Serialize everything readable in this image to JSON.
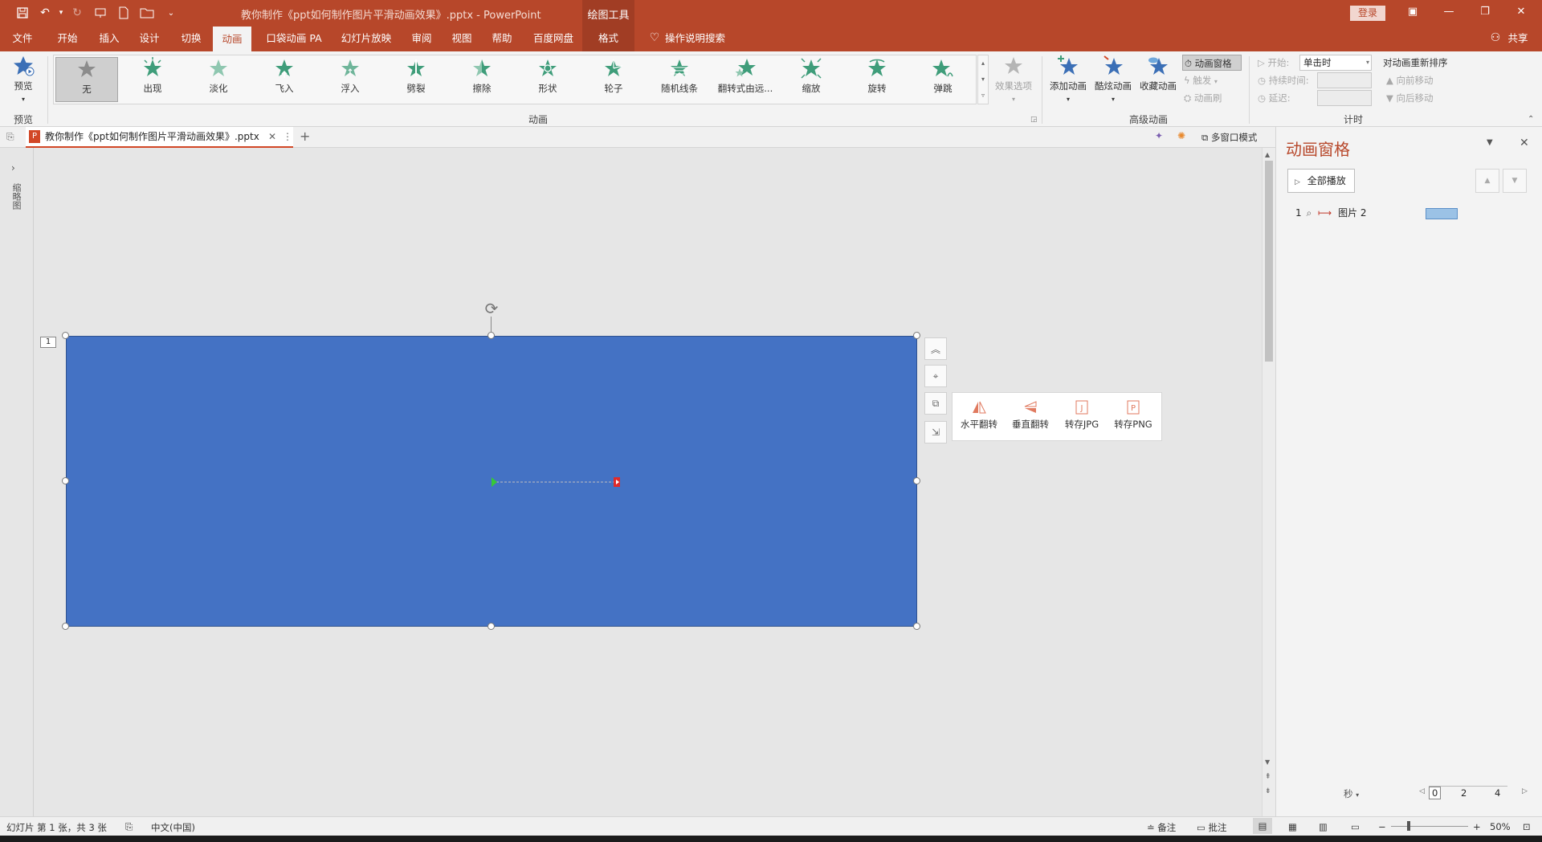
{
  "window": {
    "title": "教你制作《ppt如何制作图片平滑动画效果》.pptx - PowerPoint",
    "context_tools": "绘图工具",
    "login": "登录",
    "share": "共享"
  },
  "qat": {
    "customize": "⌄"
  },
  "tabs": [
    {
      "label": "文件"
    },
    {
      "label": "开始"
    },
    {
      "label": "插入"
    },
    {
      "label": "设计"
    },
    {
      "label": "切换"
    },
    {
      "label": "动画"
    },
    {
      "label": "口袋动画 PA"
    },
    {
      "label": "幻灯片放映"
    },
    {
      "label": "审阅"
    },
    {
      "label": "视图"
    },
    {
      "label": "帮助"
    },
    {
      "label": "百度网盘"
    },
    {
      "label": "格式"
    }
  ],
  "tell_me": "操作说明搜索",
  "ribbon": {
    "preview": {
      "label": "预览",
      "group": "预览"
    },
    "animations_group": "动画",
    "gallery": [
      {
        "label": "无"
      },
      {
        "label": "出现"
      },
      {
        "label": "淡化"
      },
      {
        "label": "飞入"
      },
      {
        "label": "浮入"
      },
      {
        "label": "劈裂"
      },
      {
        "label": "擦除"
      },
      {
        "label": "形状"
      },
      {
        "label": "轮子"
      },
      {
        "label": "随机线条"
      },
      {
        "label": "翻转式由远..."
      },
      {
        "label": "缩放"
      },
      {
        "label": "旋转"
      },
      {
        "label": "弹跳"
      }
    ],
    "effect_options": "效果选项",
    "advanced": {
      "group": "高级动画",
      "add_animation": "添加动画",
      "fancy_animation": "酷炫动画",
      "favorite_animation": "收藏动画",
      "animation_pane": "动画窗格",
      "trigger": "触发",
      "animation_painter": "动画刷"
    },
    "timing": {
      "group": "计时",
      "start_label": "开始:",
      "start_value": "单击时",
      "duration_label": "持续时间:",
      "delay_label": "延迟:",
      "reorder": "对动画重新排序",
      "move_earlier": "向前移动",
      "move_later": "向后移动"
    }
  },
  "doc_tab": {
    "name": "教你制作《ppt如何制作图片平滑动画效果》.pptx"
  },
  "left_rail": {
    "label": "缩略图"
  },
  "slide": {
    "anim_tag": "1"
  },
  "flip_panel": [
    {
      "label": "水平翻转"
    },
    {
      "label": "垂直翻转"
    },
    {
      "label": "转存JPG"
    },
    {
      "label": "转存PNG"
    }
  ],
  "animation_pane": {
    "title": "动画窗格",
    "play_all": "全部播放",
    "items": [
      {
        "index": "1",
        "name": "图片 2"
      }
    ],
    "seconds": "秒",
    "timeline": [
      "0",
      "2",
      "4"
    ]
  },
  "multi_window": "多窗口模式",
  "status": {
    "slide_info": "幻灯片 第 1 张，共 3 张",
    "language": "中文(中国)",
    "notes": "备注",
    "comments": "批注",
    "zoom": "50%"
  },
  "colors": {
    "brand": "#b7472a",
    "shape_fill": "#4472c4",
    "timeline_bar": "#9bc2e6",
    "star_green": "#3f9d7a",
    "star_blue": "#3b6fb6"
  }
}
